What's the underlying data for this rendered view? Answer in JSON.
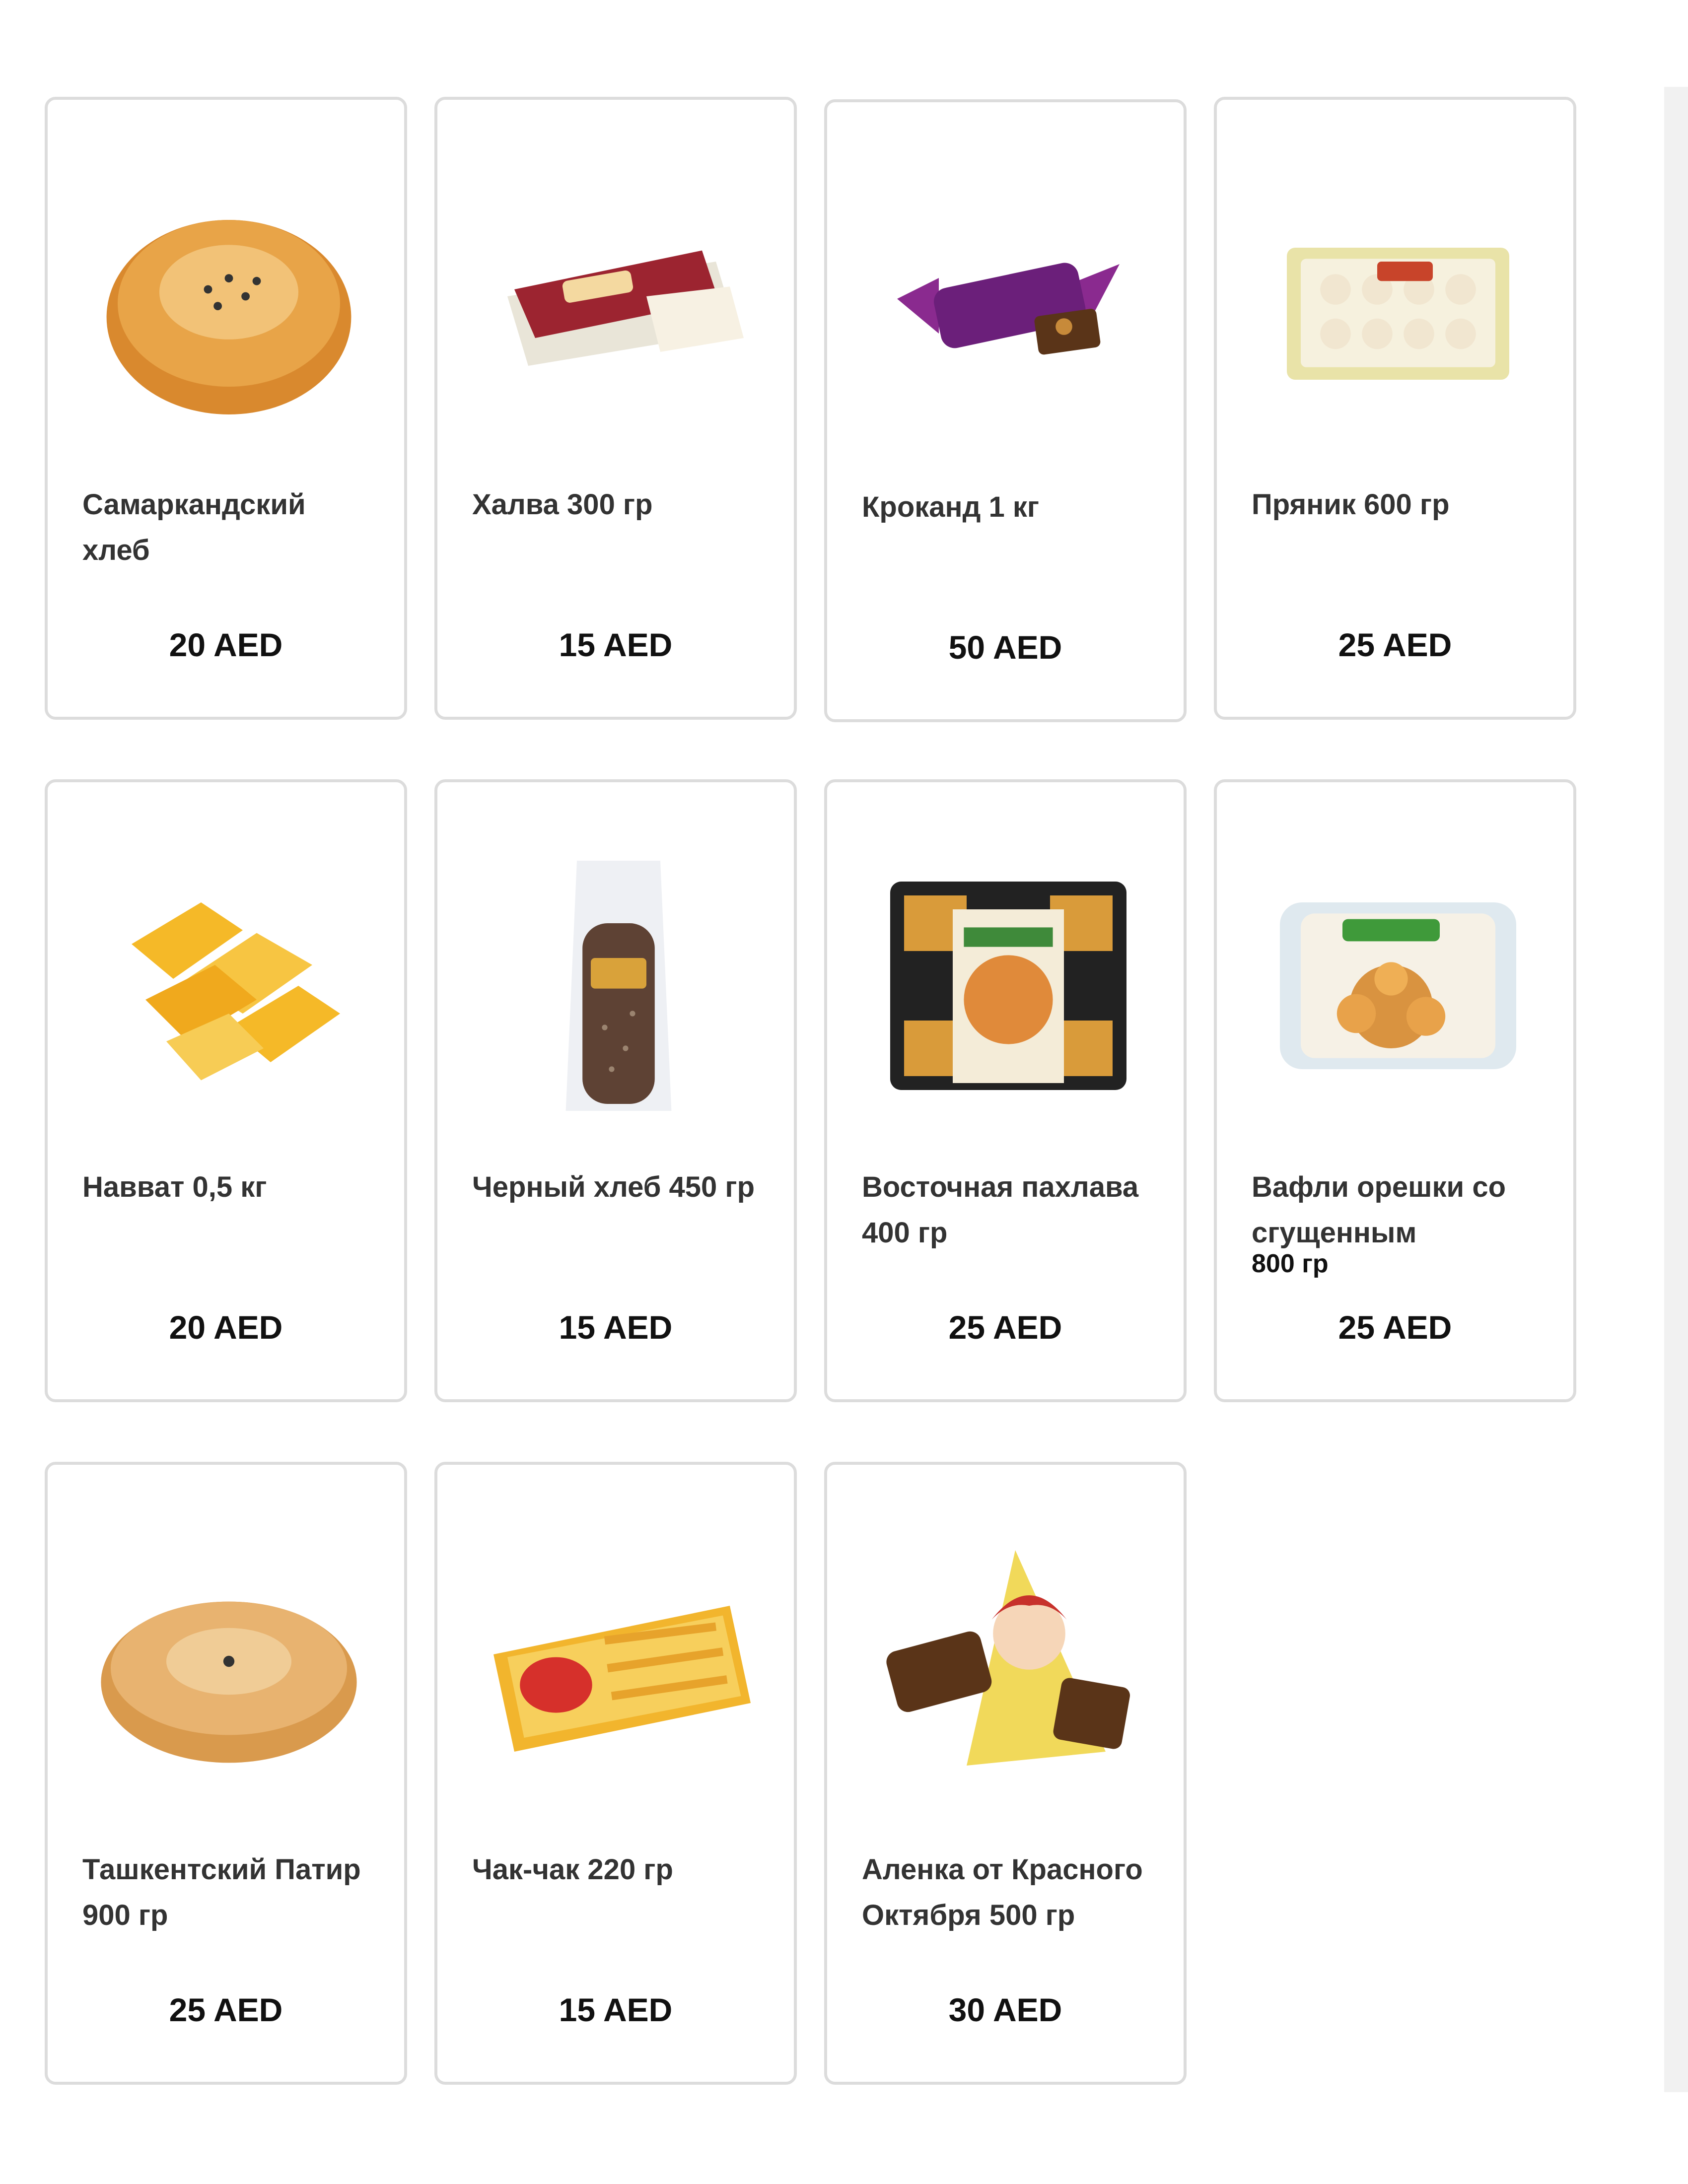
{
  "products": [
    {
      "name": "Самаркандский хлеб",
      "price": "20 AED",
      "icon": "round-bread-icon"
    },
    {
      "name": "Халва 300 гр",
      "price": "15 AED",
      "icon": "halva-pack-icon"
    },
    {
      "name": "Кроканд 1 кг",
      "price": "50 AED",
      "icon": "candy-wrapper-icon"
    },
    {
      "name": "Пряник 600 гр",
      "price": "25 AED",
      "icon": "gingerbread-box-icon"
    },
    {
      "name": "Навват 0,5 кг",
      "price": "20 AED",
      "icon": "crystal-sugar-icon"
    },
    {
      "name": "Черный хлеб 450 гр",
      "price": "15 AED",
      "icon": "bagged-bread-icon"
    },
    {
      "name": "Восточная пахлава 400 гр",
      "price": "25 AED",
      "icon": "baklava-box-icon"
    },
    {
      "name": "Вафли орешки со сгущенным",
      "subtitle": "800 гр",
      "price": "25 AED",
      "icon": "waffle-nuts-box-icon"
    },
    {
      "name": "Ташкентский Патир 900 гр",
      "price": "25 AED",
      "icon": "patir-bread-icon"
    },
    {
      "name": "Чак-чак 220 гр",
      "price": "15 AED",
      "icon": "chak-chak-pack-icon"
    },
    {
      "name": "Аленка от Красного Октября 500 гр",
      "price": "30 AED",
      "icon": "chocolate-candy-icon"
    }
  ],
  "colors": {
    "card_border": "#dcdcdc",
    "name_text": "#333333",
    "price_text": "#111111"
  }
}
